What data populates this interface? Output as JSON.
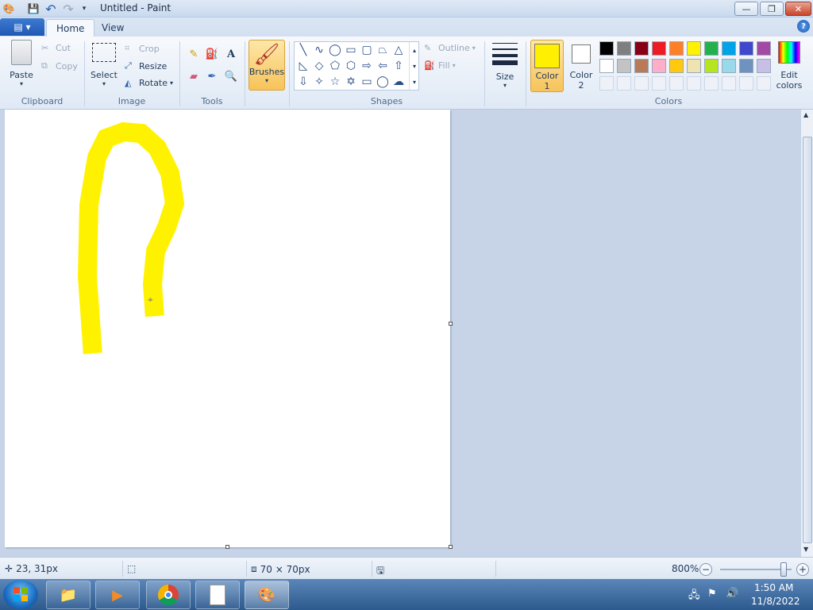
{
  "window": {
    "title": "Untitled - Paint",
    "minimize": "—",
    "maximize": "❐",
    "close": "✕"
  },
  "qat": {
    "app_icon": "paint-app-icon",
    "save": "save-icon",
    "undo": "undo-icon",
    "redo": "redo-icon",
    "customize": "customize-qat-icon"
  },
  "tabs": {
    "file": "▤ ▾",
    "home": "Home",
    "view": "View",
    "help": "?"
  },
  "clipboard": {
    "paste": "Paste",
    "cut": "Cut",
    "copy": "Copy",
    "group": "Clipboard"
  },
  "image": {
    "select": "Select",
    "crop": "Crop",
    "resize": "Resize",
    "rotate": "Rotate",
    "group": "Image"
  },
  "tools": {
    "group": "Tools"
  },
  "brushes": {
    "label": "Brushes"
  },
  "shapes": {
    "outline": "Outline",
    "fill": "Fill",
    "group": "Shapes"
  },
  "size": {
    "label": "Size"
  },
  "color1": {
    "label": "Color",
    "num": "1",
    "value": "#ffef00"
  },
  "color2": {
    "label": "Color",
    "num": "2",
    "value": "#ffffff"
  },
  "colors": {
    "group": "Colors",
    "edit_label": "Edit",
    "edit_label2": "colors",
    "row1": [
      "#000000",
      "#7f7f7f",
      "#880015",
      "#ed1c24",
      "#ff7f27",
      "#fff200",
      "#22b14c",
      "#00a2e8",
      "#3f48cc",
      "#a349a4"
    ],
    "row2": [
      "#ffffff",
      "#c3c3c3",
      "#b97a57",
      "#ffaec9",
      "#ffc90e",
      "#efe4b0",
      "#b5e61d",
      "#99d9ea",
      "#7092be",
      "#c8bfe7"
    ]
  },
  "status": {
    "cursor_pos": "23, 31px",
    "image_size": "70 × 70px",
    "zoom": "800%"
  },
  "tray": {
    "time": "1:50 AM",
    "date": "11/8/2022"
  }
}
